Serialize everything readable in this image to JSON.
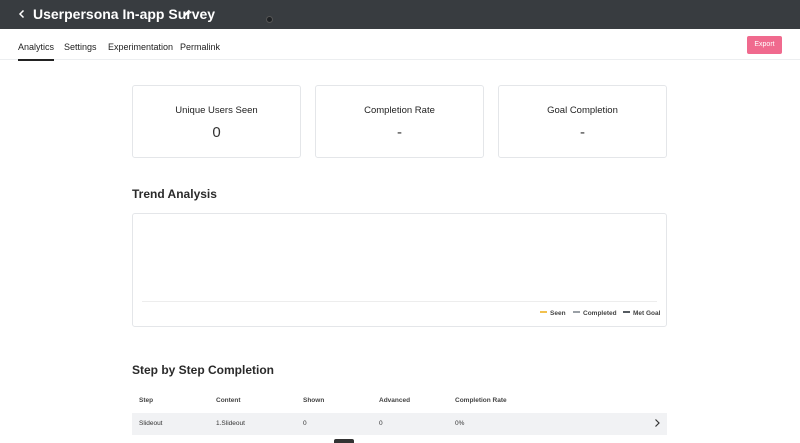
{
  "header": {
    "back_icon": "chevron-left-icon",
    "title": "Userpersona  In-app Survey",
    "edit_icon": "pencil-icon"
  },
  "tabs": [
    {
      "label": "Analytics",
      "active": true
    },
    {
      "label": "Settings",
      "active": false
    },
    {
      "label": "Experimentation",
      "active": false
    },
    {
      "label": "Permalink",
      "active": false
    }
  ],
  "toolbar": {
    "export_label": "Export",
    "export_color": "#f06a8e"
  },
  "stats": [
    {
      "label": "Unique Users Seen",
      "value": "0"
    },
    {
      "label": "Completion Rate",
      "value": "-"
    },
    {
      "label": "Goal Completion",
      "value": "-"
    }
  ],
  "trend": {
    "title": "Trend Analysis",
    "legend": [
      {
        "name": "Seen",
        "color": "#f2c14e"
      },
      {
        "name": "Completed",
        "color": "#9aa0a6"
      },
      {
        "name": "Met Goal",
        "color": "#555b61"
      }
    ]
  },
  "steps": {
    "title": "Step by Step Completion",
    "columns": [
      "Step",
      "Content",
      "Shown",
      "Advanced",
      "Completion Rate"
    ],
    "rows": [
      {
        "step": "Slideout",
        "content": "1.Slideout",
        "shown": "0",
        "advanced": "0",
        "completion_rate": "0%"
      }
    ]
  }
}
